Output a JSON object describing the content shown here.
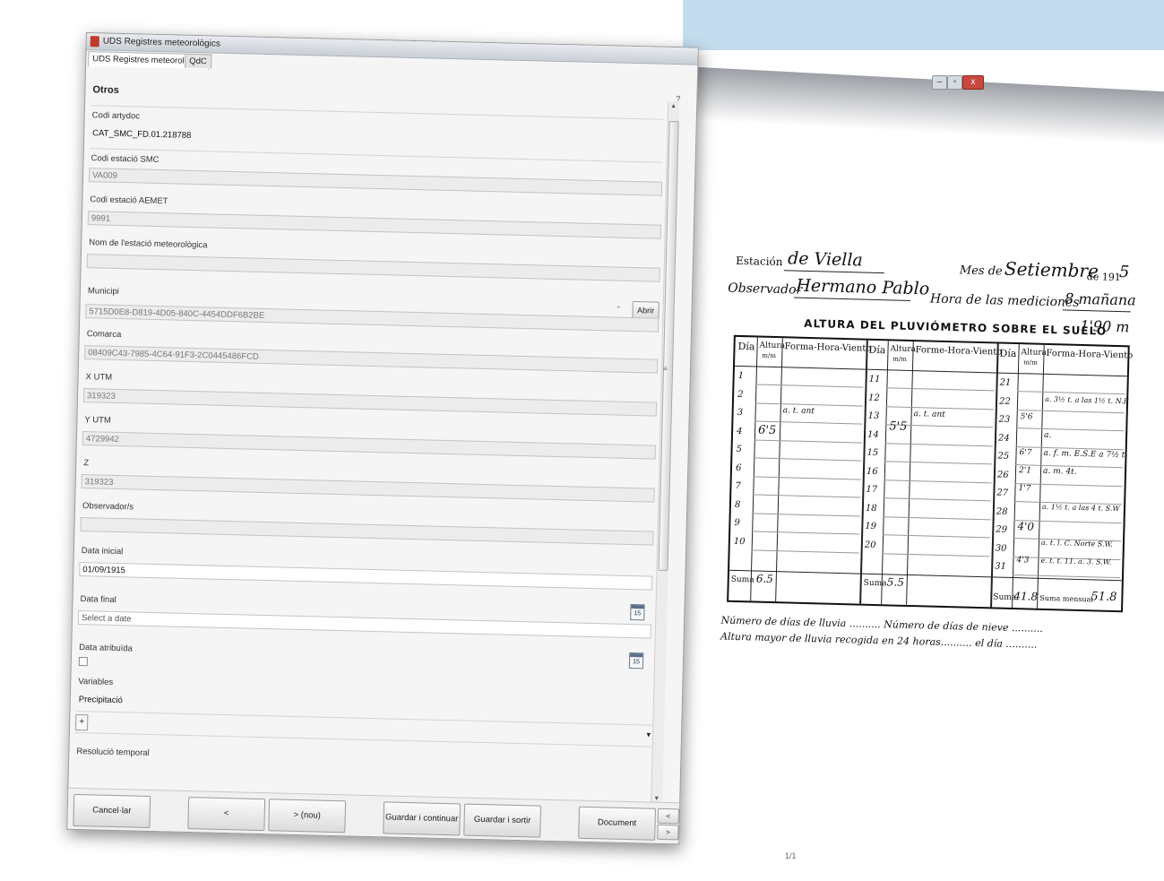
{
  "background_window": {
    "buttons": {
      "minimize": "–",
      "maximize": "▫",
      "close": "x"
    },
    "banner_color": "#c3ddee"
  },
  "window": {
    "title": "UDS Registres meteorològics",
    "tabs": [
      {
        "label": "UDS Registres meteorològics",
        "active": true
      },
      {
        "label": "QdC",
        "active": false
      }
    ],
    "help": "?",
    "section_title": "Otros"
  },
  "form": {
    "codi_artydoc": {
      "label": "Codi artydoc",
      "value": "CAT_SMC_FD.01.218788"
    },
    "codi_smc": {
      "label": "Codi estació SMC",
      "value": "VA009"
    },
    "codi_aemet": {
      "label": "Codi estació AEMET",
      "value": "9991"
    },
    "nom_estacio": {
      "label": "Nom de l'estació meteorològica",
      "value": ""
    },
    "municipi": {
      "label": "Municipi",
      "value": "",
      "button": "Abrir"
    },
    "municipi_id": {
      "value": "5715D0E8-D819-4D05-840C-4454DDF6B2BE"
    },
    "comarca": {
      "label": "Comarca",
      "value": "08409C43-7985-4C64-91F3-2C0445486FCD"
    },
    "x_utm": {
      "label": "X UTM",
      "value": "319323"
    },
    "y_utm": {
      "label": "Y UTM",
      "value": "4729942"
    },
    "z": {
      "label": "Z",
      "value": "319323"
    },
    "observador": {
      "label": "Observador/s",
      "value": ""
    },
    "data_inicial": {
      "label": "Data inicial",
      "value": "01/09/1915"
    },
    "data_final": {
      "label": "Data final",
      "placeholder": "Select a date"
    },
    "data_atribuida": {
      "label": "Data atribuïda",
      "checked": false
    },
    "variables": {
      "label": "Variables",
      "value": "Precipitació",
      "add": "+"
    },
    "resolucio": {
      "label": "Resolució temporal"
    },
    "calendar_day": "15"
  },
  "footer": {
    "cancel": "Cancel·lar",
    "prev": "<",
    "next_new": "> (nou)",
    "save_continue": "Guardar i continuar",
    "save_exit": "Guardar i sortir",
    "document": "Document",
    "doc_prev": "<",
    "doc_next": ">"
  },
  "viewer": {
    "page_indicator": "1/1",
    "document": {
      "estacion_label": "Estación",
      "estacion": "de Viella",
      "observador_label": "Observador",
      "observador": "Hermano Pablo",
      "mes_label": "Mes de",
      "mes": "Setiembre",
      "anio_label": "de 191",
      "anio": "5",
      "hora_label": "Hora de las mediciones",
      "hora": "8 mañana",
      "altura_title": "ALTURA DEL PLUVIÓMETRO SOBRE EL SUELO",
      "altura_value": "1'90 m",
      "headers": {
        "dia": "Día",
        "altura": "Altura",
        "altura_unit": "m/m",
        "forma": "Forma-Hora-Viento",
        "forma2": "Forme-Hora-Viento"
      },
      "days_col1": [
        "1",
        "2",
        "3",
        "4",
        "5",
        "6",
        "7",
        "8",
        "9",
        "10"
      ],
      "days_col2": [
        "11",
        "12",
        "13",
        "14",
        "15",
        "16",
        "17",
        "18",
        "19",
        "20"
      ],
      "days_col3": [
        "21",
        "22",
        "23",
        "24",
        "25",
        "26",
        "27",
        "28",
        "29",
        "30",
        "31"
      ],
      "entries": [
        {
          "key": "e3",
          "text": "a. t. ant"
        },
        {
          "key": "e4",
          "text": "6'5"
        },
        {
          "key": "e12",
          "text": "a. t. ant"
        },
        {
          "key": "e13",
          "text": "5'5"
        },
        {
          "key": "e21",
          "text": "a. 3½ t. a las 1½ t. N.E"
        },
        {
          "key": "e22",
          "text": "5'6"
        },
        {
          "key": "e23",
          "text": "a."
        },
        {
          "key": "e24a",
          "text": "6'7"
        },
        {
          "key": "e24b",
          "text": "a. f. m. E.S.E a 7½ t."
        },
        {
          "key": "e25a",
          "text": "2'1"
        },
        {
          "key": "e25b",
          "text": "a. m. 4t."
        },
        {
          "key": "e26",
          "text": "1'7"
        },
        {
          "key": "e27",
          "text": "a. 1½ t. a las 4 t. S.W"
        },
        {
          "key": "e28",
          "text": "4'0"
        },
        {
          "key": "e29",
          "text": "a. t. l. C. Norte S.W."
        },
        {
          "key": "e30a",
          "text": "4'3"
        },
        {
          "key": "e30b",
          "text": "e. t. t. 11. a. 3. S.W."
        }
      ],
      "suma1_label": "Suma",
      "suma1": "6.5",
      "suma2_label": "Suma",
      "suma2": "5.5",
      "suma3_label": "Suma",
      "suma3": "41.8",
      "suma_mensual_label": "Suma mensual",
      "suma_mensual": "51.8",
      "footer_line1": "Número de días de lluvia .......... Número de días de nieve ..........",
      "footer_line2": "Altura mayor de lluvia recogida en 24 horas.......... el día .........."
    }
  }
}
